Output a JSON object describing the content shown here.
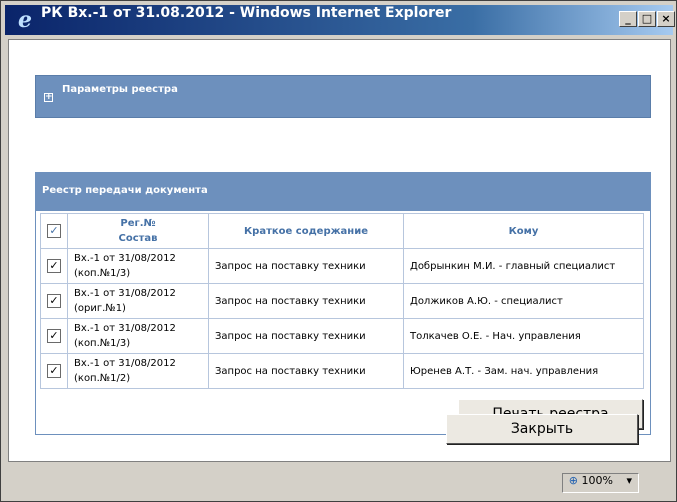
{
  "window": {
    "title": "РК Вх.-1 от 31.08.2012 - Windows Internet Explorer",
    "controls": {
      "minimize": "_",
      "maximize": "□",
      "close": "×"
    }
  },
  "params_panel": {
    "expand": "+",
    "label": "Параметры реестра"
  },
  "registry_panel": {
    "label": "Реестр передачи документа",
    "columns": {
      "check": "✓",
      "reg_no": "Рег.№",
      "sostav": "Состав",
      "content": "Краткое содержание",
      "to": "Кому"
    },
    "rows": [
      {
        "checked": "✓",
        "reg": "Вх.-1 от 31/08/2012",
        "copy": "(коп.№1/3)",
        "content": "Запрос на поставку техники",
        "to": "Добрынкин М.И. - главный специалист"
      },
      {
        "checked": "✓",
        "reg": "Вх.-1 от 31/08/2012",
        "copy": "(ориг.№1)",
        "content": "Запрос на поставку техники",
        "to": "Должиков А.Ю. - специалист"
      },
      {
        "checked": "✓",
        "reg": "Вх.-1 от 31/08/2012",
        "copy": "(коп.№1/3)",
        "content": "Запрос на поставку техники",
        "to": "Толкачев О.Е. - Нач. управления"
      },
      {
        "checked": "✓",
        "reg": "Вх.-1 от 31/08/2012",
        "copy": "(коп.№1/2)",
        "content": "Запрос на поставку техники",
        "to": "Юренев А.Т. - Зам. нач. управления"
      }
    ],
    "print_button": "Печать реестра"
  },
  "close_button": "Закрыть",
  "statusbar": {
    "zoom": "100%",
    "zoom_arrow": "▾"
  }
}
